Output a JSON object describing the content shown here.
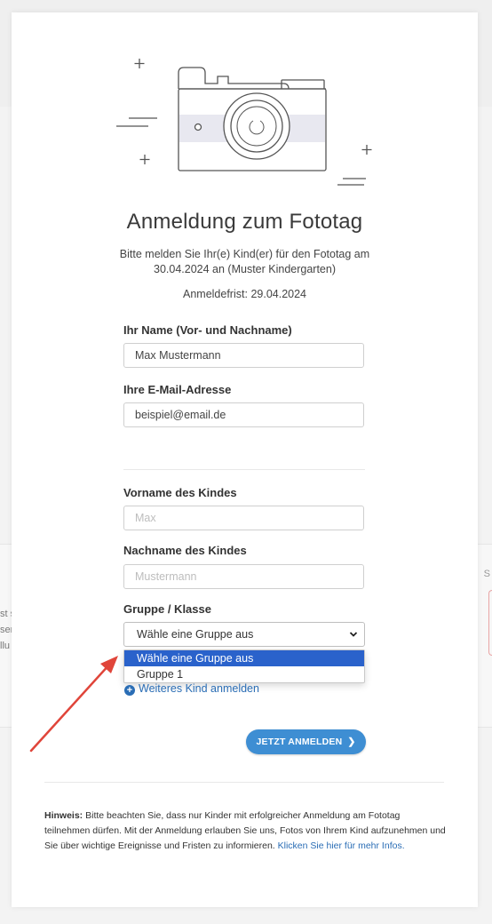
{
  "form": {
    "title": "Anmeldung zum Fototag",
    "subtitle": "Bitte melden Sie Ihr(e) Kind(er) für den Fototag am 30.04.2024 an (Muster Kindergarten)",
    "deadline_label": "Anmeldefrist:",
    "deadline_value": "29.04.2024",
    "name_label": "Ihr Name (Vor- und Nachname)",
    "name_value": "Max Mustermann",
    "email_label": "Ihre E-Mail-Adresse",
    "email_value": "beispiel@email.de",
    "child_first_label": "Vorname des Kindes",
    "child_first_placeholder": "Max",
    "child_last_label": "Nachname des Kindes",
    "child_last_placeholder": "Mustermann",
    "group_label": "Gruppe / Klasse",
    "group_selected": "Wähle eine Gruppe aus",
    "group_options": [
      "Wähle eine Gruppe aus",
      "Gruppe 1"
    ],
    "add_child": "Weiteres Kind anmelden",
    "submit": "JETZT ANMELDEN"
  },
  "note": {
    "label": "Hinweis:",
    "text": "Bitte beachten Sie, dass nur Kinder mit erfolgreicher Anmeldung am Fototag teilnehmen dürfen. Mit der Anmeldung erlauben Sie uns, Fotos von Ihrem Kind aufzunehmen und Sie über wichtige Ereignisse und Fristen zu informieren.",
    "link": "Klicken Sie hier für mehr Infos."
  },
  "background": {
    "lines": [
      "st s",
      "ser",
      "llu"
    ],
    "right_letter": "S"
  },
  "colors": {
    "accent": "#3e8ed3",
    "link": "#2a6db5",
    "selected_option": "#2a62cb",
    "arrow": "#e0453a"
  },
  "icons": [
    "camera-icon",
    "chevron-down-icon",
    "plus-circle-icon",
    "chevron-right-icon",
    "arrow-annotation"
  ]
}
